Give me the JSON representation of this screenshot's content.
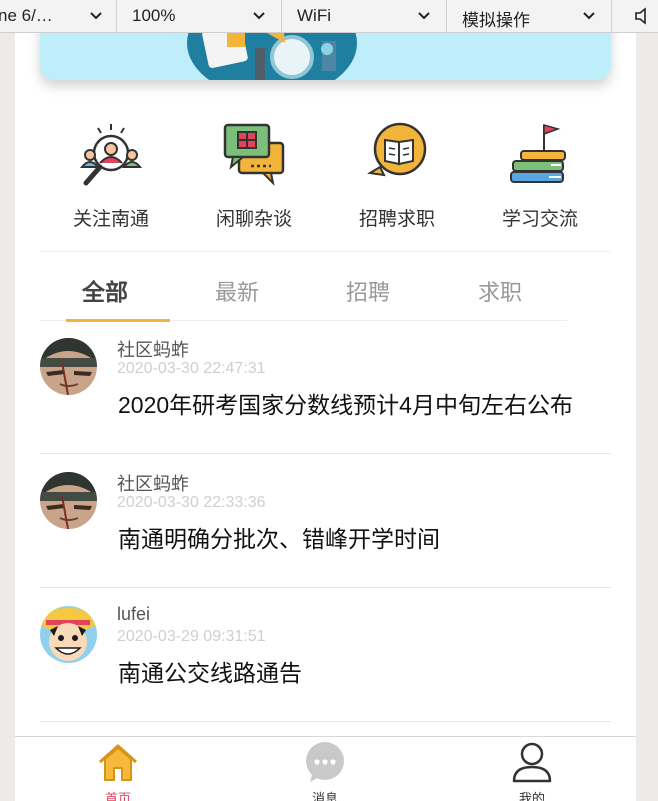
{
  "toolbar": {
    "device": "ne 6/…",
    "zoom": "100%",
    "network": "WiFi",
    "mode": "模拟操作"
  },
  "categories": [
    {
      "label": "关注南通",
      "icon": "people-search-icon"
    },
    {
      "label": "闲聊杂谈",
      "icon": "chat-bubbles-icon"
    },
    {
      "label": "招聘求职",
      "icon": "book-bubble-icon"
    },
    {
      "label": "学习交流",
      "icon": "books-flag-icon"
    }
  ],
  "tabs": [
    {
      "label": "全部",
      "active": true
    },
    {
      "label": "最新",
      "active": false
    },
    {
      "label": "招聘",
      "active": false
    },
    {
      "label": "求职",
      "active": false
    }
  ],
  "posts": [
    {
      "author": "社区蚂蚱",
      "time": "2020-03-30 22:47:31",
      "title": "2020年研考国家分数线预计4月中旬左右公布",
      "avatar": "hat-man-avatar"
    },
    {
      "author": "社区蚂蚱",
      "time": "2020-03-30 22:33:36",
      "title": "南通明确分批次、错峰开学时间",
      "avatar": "hat-man-avatar"
    },
    {
      "author": "lufei",
      "time": "2020-03-29 09:31:51",
      "title": "南通公交线路通告",
      "avatar": "straw-hat-avatar"
    }
  ],
  "tabbar": [
    {
      "label": "首页",
      "icon": "home-icon",
      "active": true
    },
    {
      "label": "消息",
      "icon": "message-icon",
      "active": false
    },
    {
      "label": "我的",
      "icon": "user-icon",
      "active": false
    }
  ],
  "colors": {
    "accent": "#f2b53a",
    "active_tab_text": "#e0435a",
    "banner": "#bdeefa"
  }
}
